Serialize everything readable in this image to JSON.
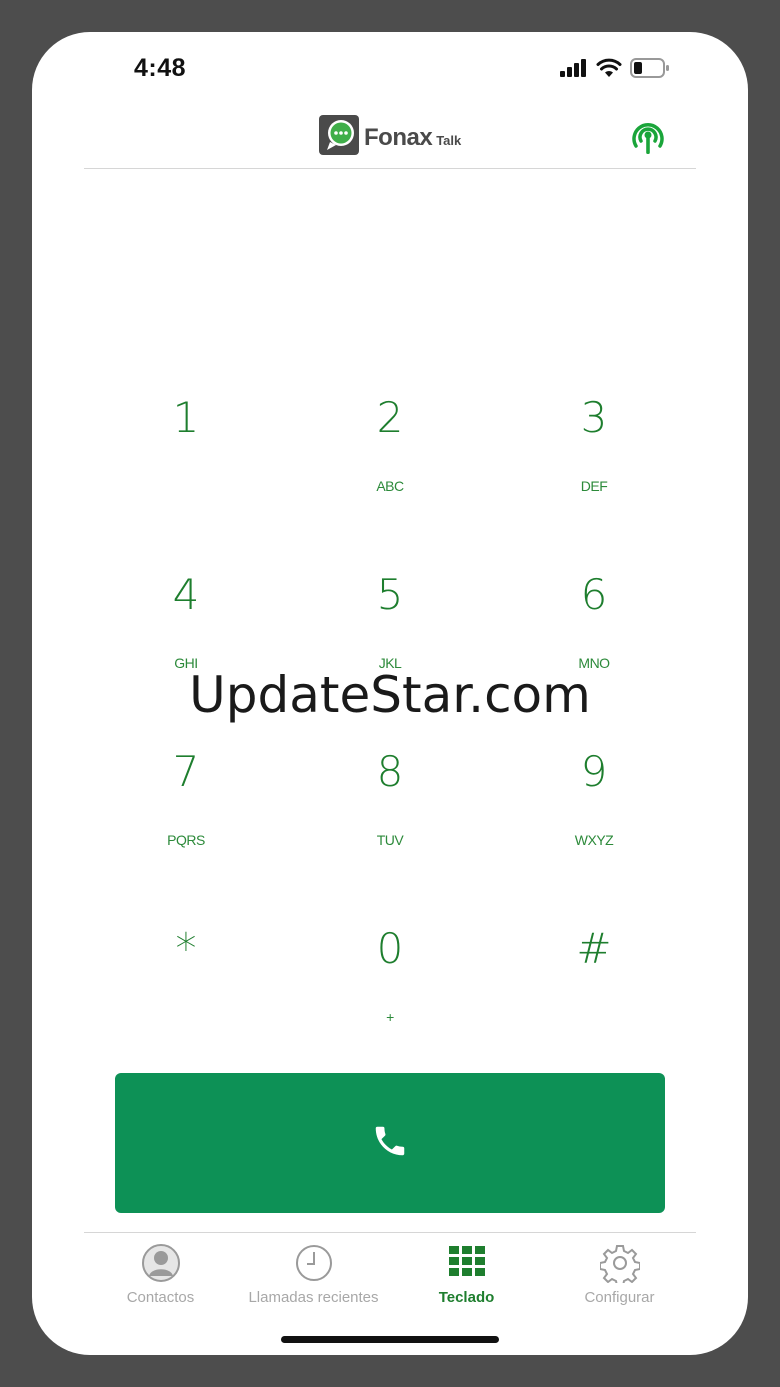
{
  "status_bar": {
    "time": "4:48",
    "icons": [
      "cellular-signal-icon",
      "wifi-icon",
      "battery-icon"
    ]
  },
  "header": {
    "logo_name": "Fonax",
    "logo_sub": "Talk",
    "signal_icon": "broadcast-signal-icon"
  },
  "keypad": {
    "keys": [
      {
        "digit": "1",
        "letters": ""
      },
      {
        "digit": "2",
        "letters": "ABC"
      },
      {
        "digit": "3",
        "letters": "DEF"
      },
      {
        "digit": "4",
        "letters": "GHI"
      },
      {
        "digit": "5",
        "letters": "JKL"
      },
      {
        "digit": "6",
        "letters": "MNO"
      },
      {
        "digit": "7",
        "letters": "PQRS"
      },
      {
        "digit": "8",
        "letters": "TUV"
      },
      {
        "digit": "9",
        "letters": "WXYZ"
      },
      {
        "digit": "*",
        "letters": ""
      },
      {
        "digit": "0",
        "letters": "+"
      },
      {
        "digit": "#",
        "letters": ""
      }
    ]
  },
  "watermark": "UpdateStar.com",
  "call_button": {
    "icon": "phone-icon"
  },
  "tabs": [
    {
      "label": "Contactos",
      "icon": "contact-icon",
      "active": false
    },
    {
      "label": "Llamadas recientes",
      "icon": "clock-icon",
      "active": false
    },
    {
      "label": "Teclado",
      "icon": "keypad-grid-icon",
      "active": true
    },
    {
      "label": "Configurar",
      "icon": "gear-icon",
      "active": false
    }
  ],
  "colors": {
    "accent": "#1e7e2e",
    "call_button": "#0d9156",
    "inactive": "#a8a8a8"
  }
}
